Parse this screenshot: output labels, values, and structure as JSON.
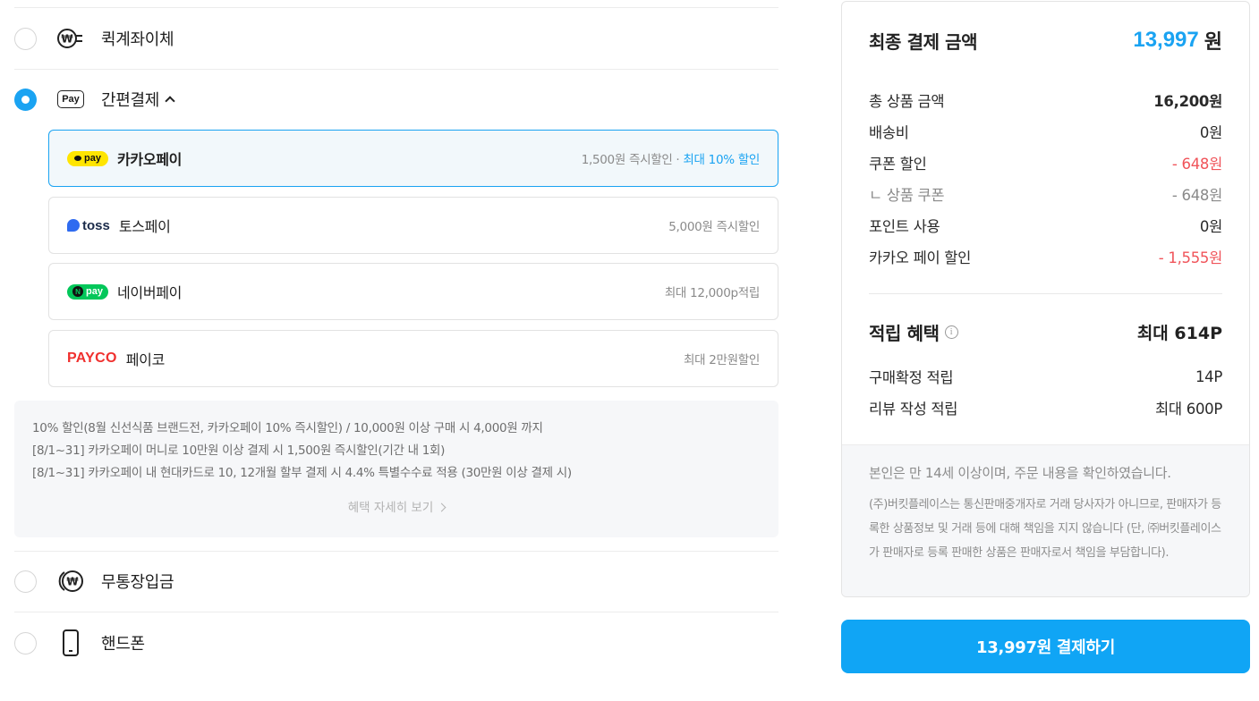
{
  "payment_methods": {
    "quick_transfer": {
      "label": "퀵계좌이체",
      "icon": "won-transfer-icon"
    },
    "easy_pay": {
      "label": "간편결제",
      "icon": "pay-icon",
      "icon_text": "Pay",
      "expanded": true,
      "options": [
        {
          "name": "카카오페이",
          "logo": "pay",
          "benefit": "1,500원 즉시할인 · ",
          "benefit_highlight": "최대 10% 할인",
          "selected": true
        },
        {
          "name": "토스페이",
          "logo": "toss",
          "benefit": "5,000원 즉시할인"
        },
        {
          "name": "네이버페이",
          "logo": "pay",
          "logo_mark": "N",
          "benefit": "최대 12,000p적립"
        },
        {
          "name": "페이코",
          "logo": "PAYCO",
          "benefit": "최대 2만원할인"
        }
      ],
      "notice": {
        "lines": [
          "10% 할인(8월 신선식품 브랜드전, 카카오페이 10% 즉시할인) / 10,000원 이상 구매 시 4,000원 까지",
          "[8/1~31] 카카오페이 머니로 10만원 이상 결제 시 1,500원 즉시할인(기간 내 1회)",
          "[8/1~31] 카카오페이 내 현대카드로 10, 12개월 할부 결제 시 4.4% 특별수수료 적용 (30만원 이상 결제 시)"
        ],
        "more_label": "혜택 자세히 보기"
      }
    },
    "bank_deposit": {
      "label": "무통장입금",
      "icon": "won-coin-icon"
    },
    "phone": {
      "label": "핸드폰",
      "icon": "phone-icon"
    }
  },
  "summary": {
    "final_label": "최종 결제 금액",
    "final_amount": "13,997",
    "final_unit": "원",
    "rows": [
      {
        "label": "총 상품 금액",
        "value": "16,200원"
      },
      {
        "label": "배송비",
        "value": "0원"
      },
      {
        "label": "쿠폰 할인",
        "value": "- 648원"
      },
      {
        "label": "ㄴ 상품 쿠폰",
        "value": "- 648원"
      },
      {
        "label": "포인트 사용",
        "value": "0원"
      },
      {
        "label": "카카오 페이 할인",
        "value": "- 1,555원"
      }
    ],
    "points": {
      "label": "적립 혜택",
      "info_glyph": "i",
      "value": "최대 614P",
      "rows": [
        {
          "label": "구매확정 적립",
          "value": "14P"
        },
        {
          "label": "리뷰 작성 적립",
          "value": "최대 600P"
        }
      ]
    },
    "agreement": "본인은 만 14세 이상이며, 주문 내용을 확인하였습니다.",
    "legal": "(주)버킷플레이스는 통신판매중개자로 거래 당사자가 아니므로, 판매자가 등록한 상품정보 및 거래 등에 대해 책임을 지지 않습니다 (단, ㈜버킷플레이스가 판매자로 등록 판매한 상품은 판매자로서 책임을 부담합니다)."
  },
  "pay_button": {
    "label": "13,997원 결제하기"
  },
  "colors": {
    "accent": "#1aa3f2",
    "discount": "#f0545a",
    "kakao": "#ffe500",
    "naver": "#03c75a",
    "payco": "#f0302e"
  }
}
